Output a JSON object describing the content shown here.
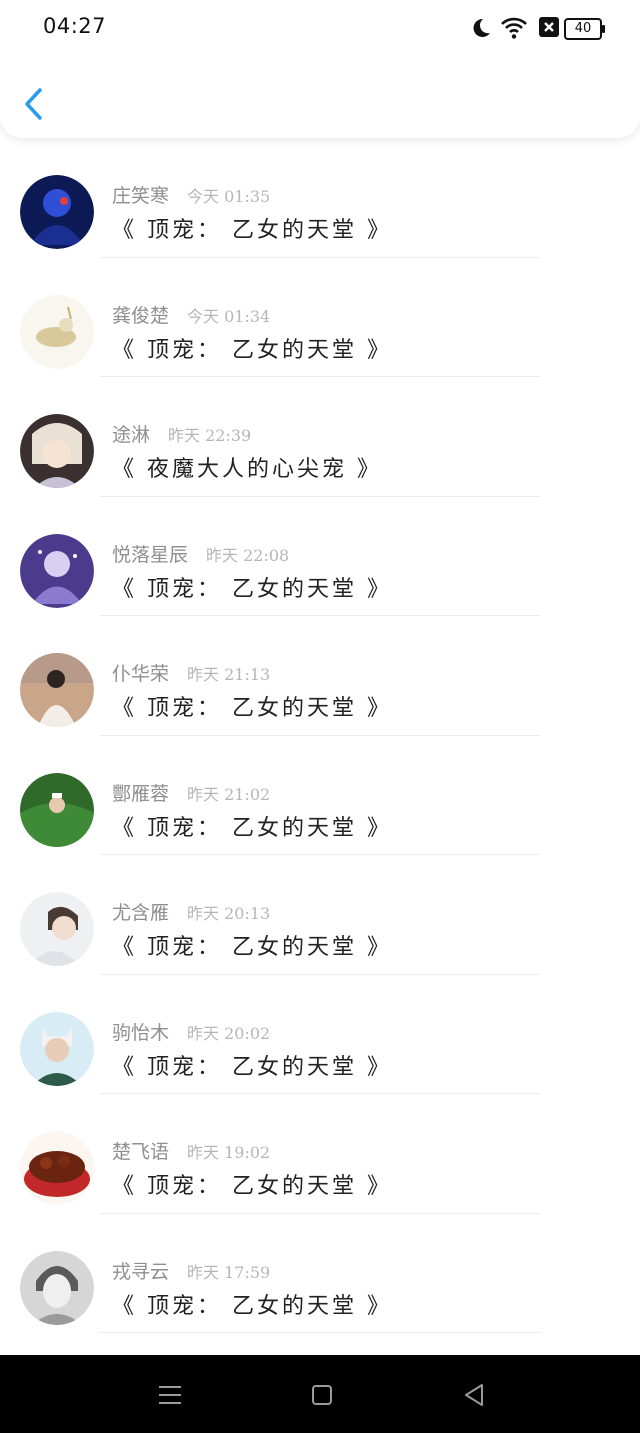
{
  "status_bar": {
    "time": "04:27",
    "battery": "40",
    "icons": [
      "moon-icon",
      "wifi-icon",
      "close-box-icon",
      "battery-icon"
    ]
  },
  "header": {
    "back_icon": "chevron-left-icon",
    "accent_color": "#2a9bf0"
  },
  "messages": [
    {
      "name": "庄笑寒",
      "time": "今天 01:35",
      "title": "《 顶宠： 乙女的天堂 》"
    },
    {
      "name": "龚俊楚",
      "time": "今天 01:34",
      "title": "《 顶宠： 乙女的天堂 》"
    },
    {
      "name": "途淋",
      "time": "昨天 22:39",
      "title": "《 夜魔大人的心尖宠 》"
    },
    {
      "name": "悦落星辰",
      "time": "昨天 22:08",
      "title": "《 顶宠： 乙女的天堂 》"
    },
    {
      "name": "仆华荣",
      "time": "昨天 21:13",
      "title": "《 顶宠： 乙女的天堂 》"
    },
    {
      "name": "酆雁蓉",
      "time": "昨天 21:02",
      "title": "《 顶宠： 乙女的天堂 》"
    },
    {
      "name": "尤含雁",
      "time": "昨天 20:13",
      "title": "《 顶宠： 乙女的天堂 》"
    },
    {
      "name": "驹怡木",
      "time": "昨天 20:02",
      "title": "《 顶宠： 乙女的天堂 》"
    },
    {
      "name": "楚飞语",
      "time": "昨天 19:02",
      "title": "《 顶宠： 乙女的天堂 》"
    },
    {
      "name": "戎寻云",
      "time": "昨天 17:59",
      "title": "《 顶宠： 乙女的天堂 》"
    }
  ],
  "navbar": {
    "icons": [
      "menu-icon",
      "home-icon",
      "back-triangle-icon"
    ]
  }
}
